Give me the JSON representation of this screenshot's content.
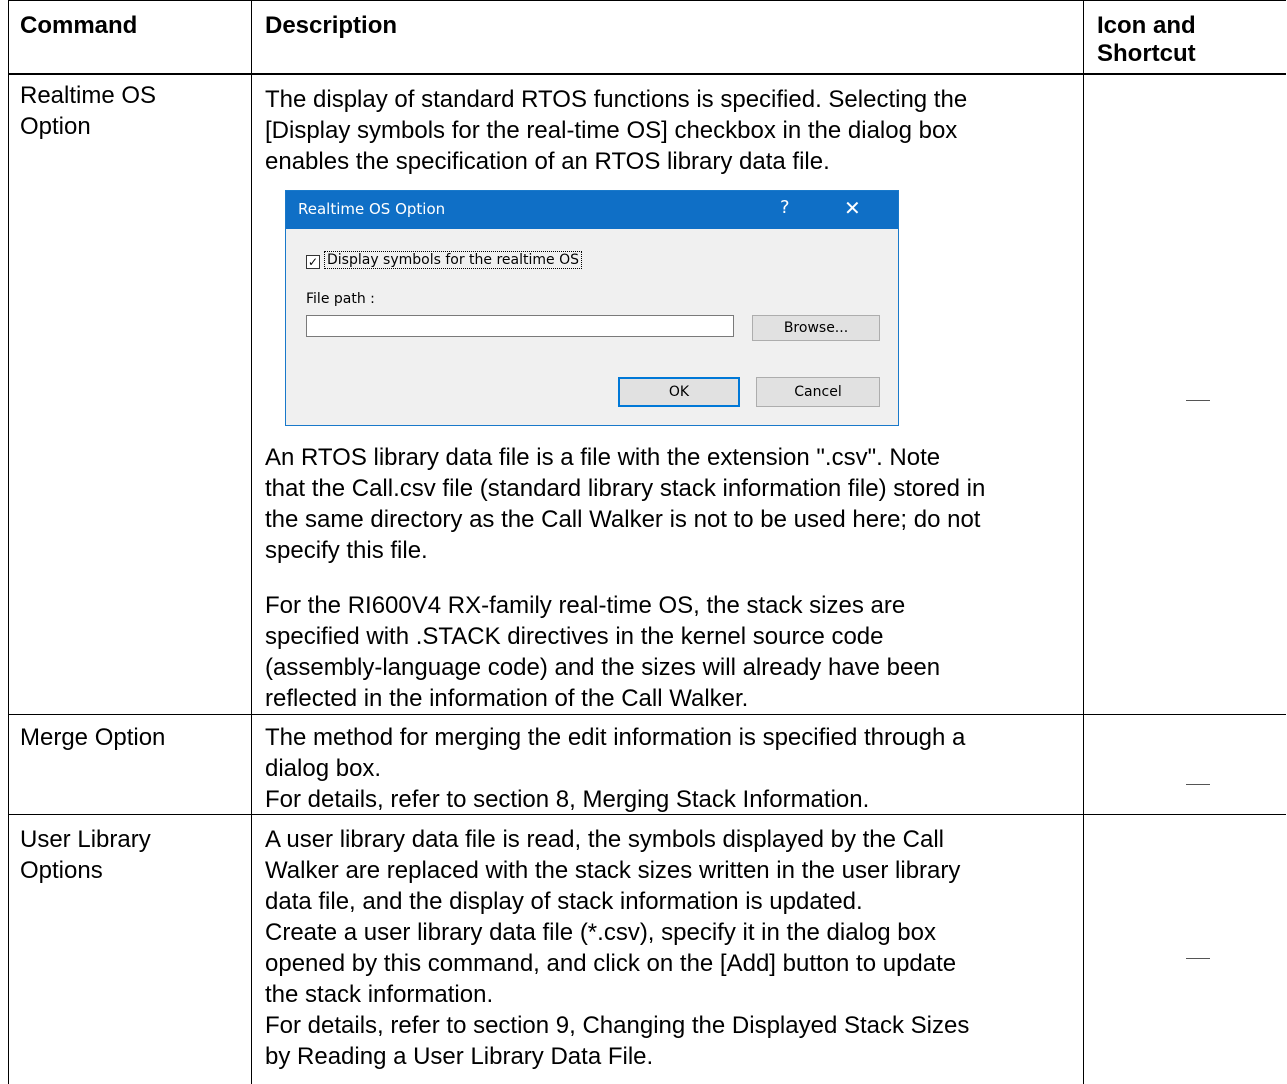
{
  "headers": {
    "command": "Command",
    "description": "Description",
    "icon_shortcut": [
      "Icon and",
      "Shortcut"
    ]
  },
  "rows": [
    {
      "command": [
        "Realtime OS",
        "Option"
      ],
      "desc_intro": [
        "The display of standard RTOS functions is specified. Selecting the",
        "[Display symbols for the real-time OS] checkbox in the dialog box",
        "enables the specification of an RTOS library data file."
      ],
      "desc_p2": [
        "An RTOS library data file is a file with the extension \".csv\". Note",
        "that the Call.csv file (standard library stack information file) stored in",
        "the same directory as the Call Walker is not to be used here; do not",
        "specify this file."
      ],
      "desc_p3": [
        "For the RI600V4 RX-family real-time OS, the stack sizes are",
        "specified with .STACK directives in the kernel source code",
        "(assembly-language code) and the sizes will already have been",
        "reflected in the information of the Call Walker."
      ],
      "icon_shortcut": "—"
    },
    {
      "command": [
        "Merge Option"
      ],
      "desc": [
        "The method for merging the edit information is specified through a",
        "dialog box.",
        "For details, refer to section 8, Merging Stack Information."
      ],
      "icon_shortcut": "—"
    },
    {
      "command": [
        "User Library",
        "Options"
      ],
      "desc": [
        "A user library data file is read, the symbols displayed by the Call",
        "Walker are replaced with the stack sizes written in the user library",
        "data file, and the display of stack information is updated.",
        "Create a user library data file (*.csv), specify it in the dialog box",
        "opened by this command, and click on the [Add] button to update",
        "the stack information.",
        "For details, refer to section 9, Changing the Displayed Stack Sizes",
        "by Reading a User Library Data File."
      ],
      "icon_shortcut": "—"
    }
  ],
  "dialog": {
    "title": "Realtime OS Option",
    "help": "?",
    "close": "✕",
    "checkbox_checked": true,
    "checkbox_label": "Display symbols for the realtime OS",
    "file_path_label": "File path :",
    "file_path_value": "",
    "browse_label": "Browse...",
    "ok_label": "OK",
    "cancel_label": "Cancel"
  }
}
